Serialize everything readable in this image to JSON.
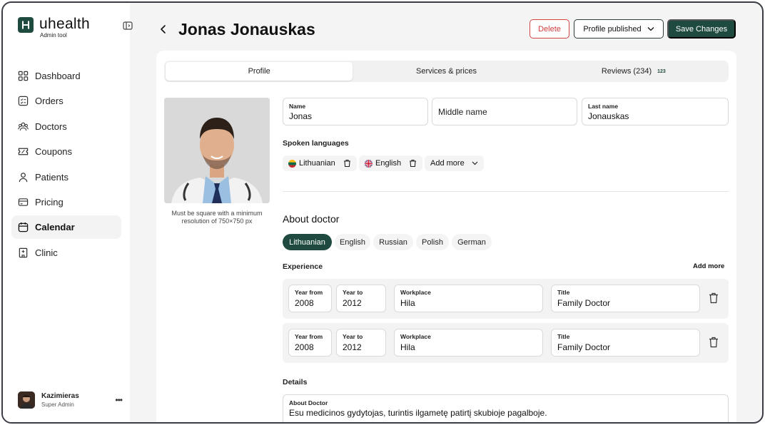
{
  "brand": {
    "name": "uhealth",
    "subtitle": "Admin tool",
    "logo_letter": "H"
  },
  "sidebar": {
    "items": [
      {
        "label": "Dashboard",
        "icon": "dashboard-icon"
      },
      {
        "label": "Orders",
        "icon": "orders-icon"
      },
      {
        "label": "Doctors",
        "icon": "doctors-icon"
      },
      {
        "label": "Coupons",
        "icon": "coupons-icon"
      },
      {
        "label": "Patients",
        "icon": "patients-icon"
      },
      {
        "label": "Pricing",
        "icon": "pricing-icon"
      },
      {
        "label": "Calendar",
        "icon": "calendar-icon",
        "active": true
      },
      {
        "label": "Clinic",
        "icon": "clinic-icon"
      }
    ],
    "user": {
      "name": "Kazimieras",
      "role": "Super Admin",
      "more": "•••"
    }
  },
  "header": {
    "title": "Jonas Jonauskas",
    "delete_label": "Delete",
    "status_label": "Profile published",
    "save_label": "Save Changes"
  },
  "tabs": [
    {
      "label": "Profile",
      "active": true
    },
    {
      "label": "Services & prices"
    },
    {
      "label": "Reviews (234)",
      "badge": "123"
    }
  ],
  "photo": {
    "caption": "Must be square with a minimum resolution of 750×750 px"
  },
  "name_fields": {
    "first": {
      "label": "Name",
      "value": "Jonas"
    },
    "middle": {
      "placeholder": "Middle name"
    },
    "last": {
      "label": "Last name",
      "value": "Jonauskas"
    }
  },
  "spoken_languages": {
    "label": "Spoken languages",
    "items": [
      "Lithuanian",
      "English"
    ],
    "add_more": "Add more"
  },
  "about": {
    "title": "About doctor",
    "language_tabs": [
      "Lithuanian",
      "English",
      "Russian",
      "Polish",
      "German"
    ],
    "active_language": "Lithuanian"
  },
  "experience": {
    "label": "Experience",
    "add_more": "Add more",
    "rows": [
      {
        "year_from_label": "Year from",
        "year_from": "2008",
        "year_to_label": "Year to",
        "year_to": "2012",
        "workplace_label": "Workplace",
        "workplace": "Hila",
        "title_label": "Title",
        "title": "Family Doctor"
      },
      {
        "year_from_label": "Year from",
        "year_from": "2008",
        "year_to_label": "Year to",
        "year_to": "2012",
        "workplace_label": "Workplace",
        "workplace": "Hila",
        "title_label": "Title",
        "title": "Family Doctor"
      }
    ]
  },
  "details": {
    "label": "Details",
    "about_label": "About Doctor",
    "about_value": "Esu medicinos gydytojas, turintis ilgametę patirtį skubioje pagalboje."
  },
  "colors": {
    "accent": "#1f4a3f",
    "danger": "#d23b3b",
    "background": "#f4f4f4"
  }
}
